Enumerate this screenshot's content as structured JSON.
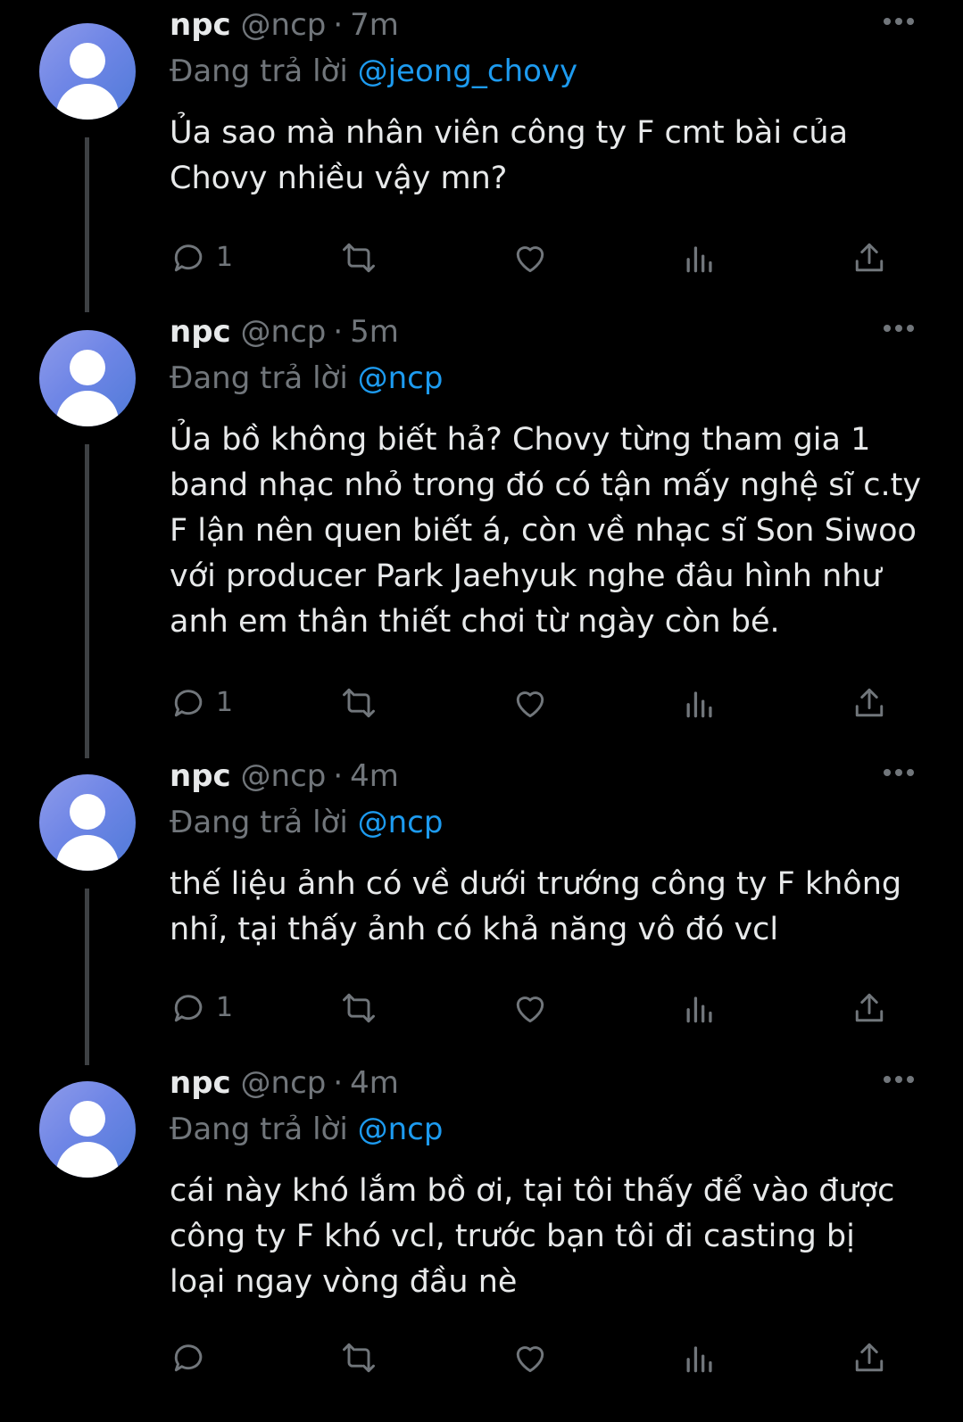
{
  "tweets": [
    {
      "name": "npc",
      "handle": "@ncp",
      "separator": "·",
      "time": "7m",
      "replying_prefix": "Đang trả lời",
      "replying_to": "@jeong_chovy",
      "text": "Ủa sao mà nhân viên công ty F cmt bài của\nChovy nhiều vậy mn?",
      "reply_count": "1",
      "avatar_icon": "default-avatar-icon"
    },
    {
      "name": "npc",
      "handle": "@ncp",
      "separator": "·",
      "time": "5m",
      "replying_prefix": "Đang trả lời",
      "replying_to": "@ncp",
      "text": "Ủa bồ không biết hả? Chovy từng tham gia 1\nband nhạc nhỏ trong đó có tận mấy nghệ sĩ c.ty\nF lận nên quen biết á, còn về nhạc sĩ Son Siwoo\nvới producer Park Jaehyuk nghe đâu hình như\nanh em thân thiết chơi từ ngày còn bé.",
      "reply_count": "1",
      "avatar_icon": "default-avatar-icon"
    },
    {
      "name": "npc",
      "handle": "@ncp",
      "separator": "·",
      "time": "4m",
      "replying_prefix": "Đang trả lời",
      "replying_to": "@ncp",
      "text": "thế liệu ảnh có về dưới trướng công ty F không\nnhỉ, tại thấy ảnh có khả năng vô đó vcl",
      "reply_count": "1",
      "avatar_icon": "default-avatar-icon"
    },
    {
      "name": "npc",
      "handle": "@ncp",
      "separator": "·",
      "time": "4m",
      "replying_prefix": "Đang trả lời",
      "replying_to": "@ncp",
      "text": "cái này khó lắm bồ ơi, tại tôi thấy để vào được\ncông ty F khó vcl, trước bạn tôi đi casting bị\nloại ngay vòng đầu nè",
      "reply_count": "",
      "avatar_icon": "default-avatar-icon"
    }
  ],
  "colors": {
    "background": "#000000",
    "text": "#e7e9ea",
    "muted": "#71767b",
    "mention": "#1d9bf0",
    "thread_line": "#3e4144"
  },
  "action_icons": [
    "reply-icon",
    "retweet-icon",
    "like-icon",
    "views-icon",
    "share-icon"
  ]
}
